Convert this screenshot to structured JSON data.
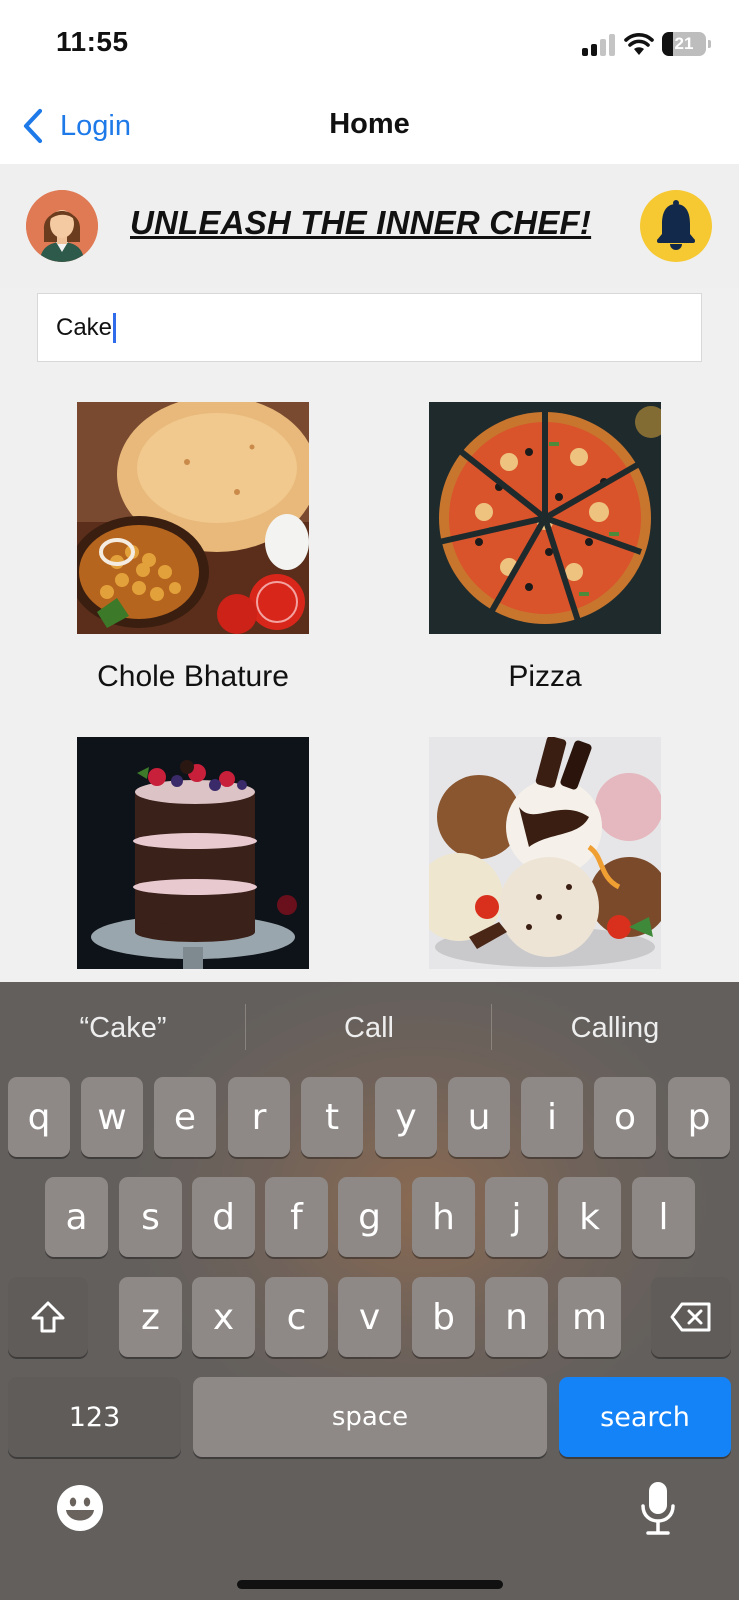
{
  "status_bar": {
    "time": "11:55",
    "battery": "21"
  },
  "nav": {
    "back_label": "Login",
    "title": "Home"
  },
  "header": {
    "tagline": "UNLEASH THE INNER CHEF!"
  },
  "search": {
    "value": "Cake"
  },
  "recipes": [
    {
      "name": "Chole Bhature"
    },
    {
      "name": "Pizza"
    },
    {
      "name": ""
    },
    {
      "name": ""
    }
  ],
  "keyboard": {
    "suggestions": [
      "“Cake”",
      "Call",
      "Calling"
    ],
    "row1": [
      "q",
      "w",
      "e",
      "r",
      "t",
      "y",
      "u",
      "i",
      "o",
      "p"
    ],
    "row2": [
      "a",
      "s",
      "d",
      "f",
      "g",
      "h",
      "j",
      "k",
      "l"
    ],
    "row3": [
      "z",
      "x",
      "c",
      "v",
      "b",
      "n",
      "m"
    ],
    "numbers_label": "123",
    "space_label": "space",
    "search_label": "search"
  },
  "colors": {
    "accent": "#1e7ae8",
    "bell": "#f6c832",
    "search_key": "#1583f8"
  }
}
